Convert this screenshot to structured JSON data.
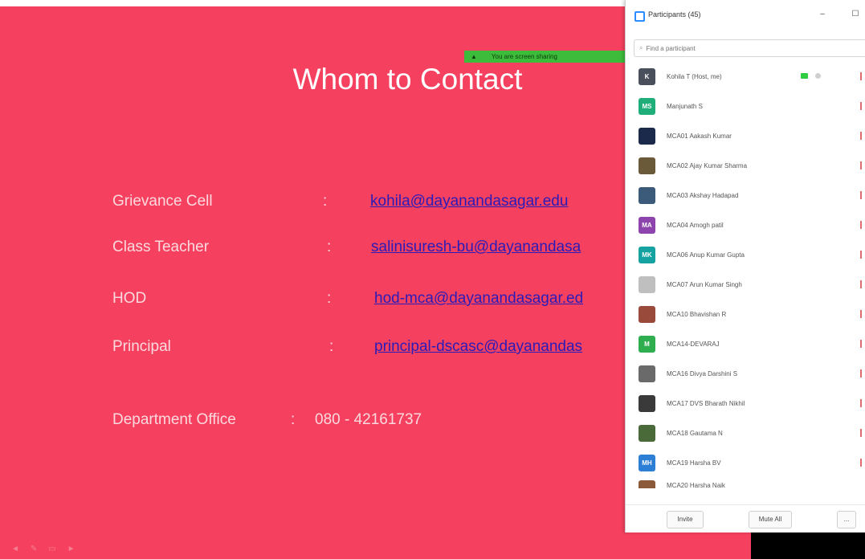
{
  "slide": {
    "title": "Whom to Contact",
    "share_banner": "You are screen sharing",
    "contacts": [
      {
        "label": "Grievance Cell",
        "colon": ":",
        "value": "kohila@dayanandasagar.edu"
      },
      {
        "label": "Class Teacher",
        "colon": ":",
        "value": "salinisuresh-bu@dayanandasa"
      },
      {
        "label": "HOD",
        "colon": ":",
        "value": "hod-mca@dayanandasagar.ed"
      },
      {
        "label": "Principal",
        "colon": ":",
        "value": "principal-dscasc@dayanandas"
      }
    ],
    "department": {
      "label": "Department Office",
      "colon": ":",
      "phone": "080 - 42161737"
    },
    "controls": [
      "◄",
      "✎",
      "▭",
      "►"
    ]
  },
  "panel": {
    "title": "Participants (45)",
    "minimize": "–",
    "maximize": "☐",
    "search_placeholder": "Find a participant",
    "participants": [
      {
        "name": "Kohila T (Host, me)",
        "initials": "K",
        "color": "#4a4f5c",
        "host": true
      },
      {
        "name": "Manjunath S",
        "initials": "MS",
        "color": "#1fae7a"
      },
      {
        "name": "MCA01 Aakash Kumar",
        "initials": "",
        "color": "#1b2a4a"
      },
      {
        "name": "MCA02 Ajay Kumar Sharma",
        "initials": "",
        "color": "#6b5a3a"
      },
      {
        "name": "MCA03 Akshay Hadapad",
        "initials": "",
        "color": "#3c5a7a"
      },
      {
        "name": "MCA04 Amogh patil",
        "initials": "MA",
        "color": "#8e44ad"
      },
      {
        "name": "MCA06 Anup Kumar Gupta",
        "initials": "MK",
        "color": "#17a2a2"
      },
      {
        "name": "MCA07 Arun Kumar Singh",
        "initials": "",
        "color": "#bfbfbf"
      },
      {
        "name": "MCA10 Bhavishan R",
        "initials": "",
        "color": "#9a4a3a"
      },
      {
        "name": "MCA14-DEVARAJ",
        "initials": "M",
        "color": "#2eae4e"
      },
      {
        "name": "MCA16 Divya Darshini S",
        "initials": "",
        "color": "#6a6a6a"
      },
      {
        "name": "MCA17 DVS Bharath Nikhil",
        "initials": "",
        "color": "#3a3a3a"
      },
      {
        "name": "MCA18 Gautama N",
        "initials": "",
        "color": "#4a6a3a"
      },
      {
        "name": "MCA19 Harsha BV",
        "initials": "MH",
        "color": "#2d7fd6"
      },
      {
        "name": "MCA20 Harsha Naik",
        "initials": "",
        "color": "#8a5a3a"
      }
    ],
    "footer": {
      "invite": "Invite",
      "mute_all": "Mute All",
      "more": "..."
    }
  },
  "colors": {
    "slide_bg": "#f5415f",
    "link": "#2b1bb8",
    "banner": "#3dbb3a",
    "zoom_blue": "#2d8cff"
  }
}
